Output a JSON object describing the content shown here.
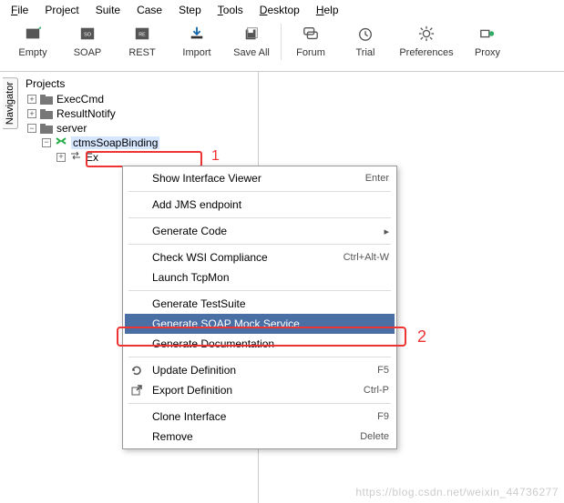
{
  "menus": {
    "file": "File",
    "project": "Project",
    "suite": "Suite",
    "case": "Case",
    "step": "Step",
    "tools": "Tools",
    "desktop": "Desktop",
    "help": "Help"
  },
  "toolbar": {
    "empty": "Empty",
    "soap": "SOAP",
    "rest": "REST",
    "import": "Import",
    "saveall": "Save All",
    "forum": "Forum",
    "trial": "Trial",
    "preferences": "Preferences",
    "proxy": "Proxy"
  },
  "sideTab": "Navigator",
  "tree": {
    "title": "Projects",
    "items": {
      "execCmd": "ExecCmd",
      "resultNotify": "ResultNotify",
      "server": "server",
      "binding": "ctmsSoapBinding",
      "exe": "Ex"
    }
  },
  "annotations": {
    "one": "1",
    "two": "2"
  },
  "ctx": {
    "showInterfaceViewer": {
      "label": "Show Interface Viewer",
      "shortcut": "Enter"
    },
    "addJmsEndpoint": {
      "label": "Add JMS endpoint",
      "shortcut": ""
    },
    "generateCode": {
      "label": "Generate Code",
      "shortcut": ""
    },
    "checkWsi": {
      "label": "Check WSI Compliance",
      "shortcut": "Ctrl+Alt-W"
    },
    "launchTcpMon": {
      "label": "Launch TcpMon",
      "shortcut": ""
    },
    "generateTestSuite": {
      "label": "Generate TestSuite",
      "shortcut": ""
    },
    "generateSoapMock": {
      "label": "Generate SOAP Mock Service",
      "shortcut": ""
    },
    "generateDocs": {
      "label": "Generate Documentation",
      "shortcut": ""
    },
    "updateDef": {
      "label": "Update Definition",
      "shortcut": "F5"
    },
    "exportDef": {
      "label": "Export Definition",
      "shortcut": "Ctrl-P"
    },
    "cloneInterface": {
      "label": "Clone Interface",
      "shortcut": "F9"
    },
    "remove": {
      "label": "Remove",
      "shortcut": "Delete"
    }
  },
  "watermark": "https://blog.csdn.net/weixin_44736277"
}
